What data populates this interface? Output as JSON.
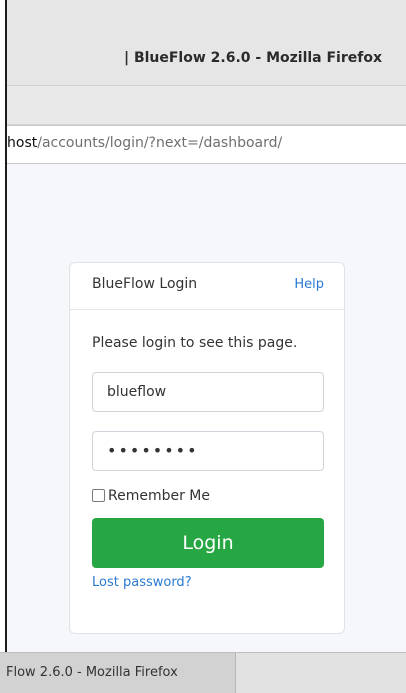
{
  "window": {
    "title": "| BlueFlow 2.6.0 - Mozilla Firefox"
  },
  "urlbar": {
    "host": "host",
    "path": "/accounts/login/?next=/dashboard/"
  },
  "login_card": {
    "title": "BlueFlow Login",
    "help_label": "Help",
    "message": "Please login to see this page.",
    "username_value": "blueflow",
    "password_value": "••••••••",
    "remember_label": "Remember Me",
    "remember_checked": false,
    "login_label": "Login",
    "lost_password_label": "Lost password?"
  },
  "taskbar": {
    "item_label": "Flow 2.6.0 - Mozilla Firefox"
  },
  "colors": {
    "primary_button": "#27a744",
    "link": "#2a7ad3"
  }
}
